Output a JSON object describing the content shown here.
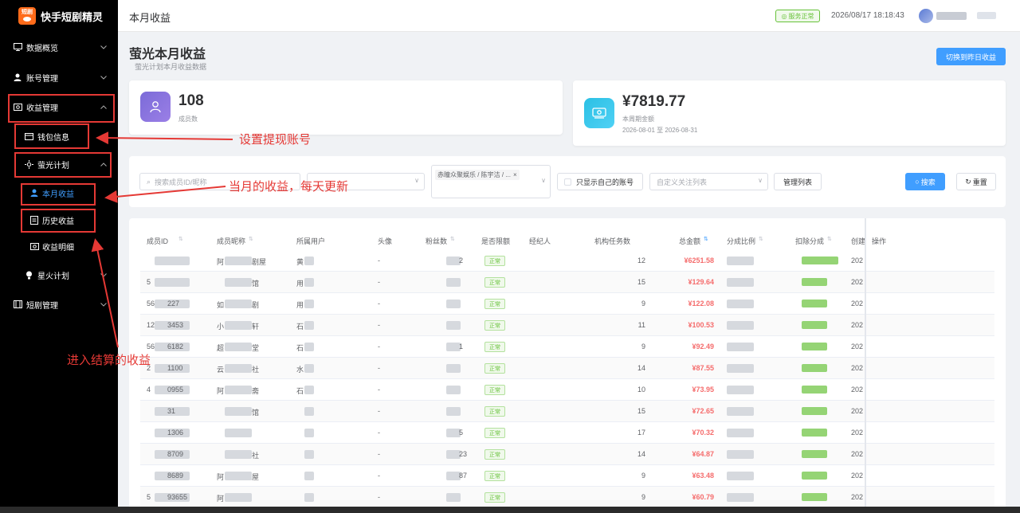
{
  "app": {
    "title": "快手短剧精灵",
    "logo_text": "短剧"
  },
  "sidebar": {
    "items": [
      {
        "label": "数据概览",
        "icon": "monitor-icon"
      },
      {
        "label": "账号管理",
        "icon": "user-icon"
      },
      {
        "label": "收益管理",
        "icon": "money-icon"
      },
      {
        "label": "钱包信息",
        "icon": "wallet-icon"
      },
      {
        "label": "萤光计划",
        "icon": "sun-icon"
      },
      {
        "label": "本月收益",
        "icon": "user-icon"
      },
      {
        "label": "历史收益",
        "icon": "document-icon"
      },
      {
        "label": "收益明细",
        "icon": "money-icon"
      },
      {
        "label": "星火计划",
        "icon": "bulb-icon"
      },
      {
        "label": "短剧管理",
        "icon": "film-icon"
      }
    ]
  },
  "header": {
    "page_title": "本月收益",
    "status": "服务正常",
    "datetime": "2026/08/17 18:18:43"
  },
  "page": {
    "title": "萤光本月收益",
    "subtitle": "萤光计划本月收益数据",
    "switch_button": "切换到昨日收益"
  },
  "stats": {
    "members": {
      "value": "108",
      "label": "成员数"
    },
    "amount": {
      "value": "¥7819.77",
      "label": "本周期金额",
      "period": "2026-08-01 至 2026-08-31"
    }
  },
  "filters": {
    "search_placeholder": "搜索成员ID/昵称",
    "tag_value": "赤瞳众聚娱乐 / 陈宇洁 / ...",
    "own_only_label": "只显示自己的账号",
    "custom_list_placeholder": "自定义关注列表",
    "manage_list": "管理列表",
    "search_button": "搜索",
    "reset_button": "重置"
  },
  "table": {
    "columns": [
      "成员ID",
      "成员昵称",
      "所属用户",
      "头像",
      "粉丝数",
      "是否限额",
      "经纪人",
      "机构任务数",
      "总金额",
      "分成比例",
      "扣除分成",
      "创建",
      "操作"
    ],
    "rows": [
      {
        "id": "",
        "nick": "阿",
        "nick2": "剧屋",
        "user": "黄",
        "avatar": "-",
        "fans": "2",
        "limit": "正常",
        "tasks": "12",
        "amount": "¥6251.58",
        "created": "202"
      },
      {
        "id": "5",
        "nick": "",
        "nick2": "馆",
        "user": "用",
        "avatar": "-",
        "fans": "",
        "limit": "正常",
        "tasks": "15",
        "amount": "¥129.64",
        "created": "202"
      },
      {
        "id": "56",
        "id2": "227",
        "nick": "如",
        "nick2": "剧",
        "user": "用",
        "avatar": "-",
        "fans": "",
        "limit": "正常",
        "tasks": "9",
        "amount": "¥122.08",
        "created": "202"
      },
      {
        "id": "12",
        "id2": "3453",
        "nick": "小",
        "nick2": "轩",
        "user": "石",
        "avatar": "-",
        "fans": "",
        "limit": "正常",
        "tasks": "11",
        "amount": "¥100.53",
        "created": "202"
      },
      {
        "id": "56",
        "id2": "6182",
        "nick": "超",
        "nick2": "堂",
        "user": "石",
        "avatar": "-",
        "fans": "1",
        "limit": "正常",
        "tasks": "9",
        "amount": "¥92.49",
        "created": "202"
      },
      {
        "id": "2",
        "id2": "1100",
        "nick": "云",
        "nick2": "社",
        "user": "水",
        "avatar": "-",
        "fans": "",
        "limit": "正常",
        "tasks": "14",
        "amount": "¥87.55",
        "created": "202"
      },
      {
        "id": "4",
        "id2": "0955",
        "nick": "阿",
        "nick2": "斋",
        "user": "石",
        "avatar": "-",
        "fans": "",
        "limit": "正常",
        "tasks": "10",
        "amount": "¥73.95",
        "created": "202"
      },
      {
        "id": "",
        "id2": "31",
        "nick": "",
        "nick2": "馆",
        "user": "",
        "avatar": "-",
        "fans": "",
        "limit": "正常",
        "tasks": "15",
        "amount": "¥72.65",
        "created": "202"
      },
      {
        "id": "",
        "id2": "1306",
        "nick": "",
        "nick2": "",
        "user": "",
        "avatar": "-",
        "fans": "5",
        "limit": "正常",
        "tasks": "17",
        "amount": "¥70.32",
        "created": "202"
      },
      {
        "id": "",
        "id2": "8709",
        "nick": "",
        "nick2": "社",
        "user": "",
        "avatar": "-",
        "fans": "23",
        "limit": "正常",
        "tasks": "14",
        "amount": "¥64.87",
        "created": "202"
      },
      {
        "id": "",
        "id2": "8689",
        "nick": "阿",
        "nick2": "屋",
        "user": "",
        "avatar": "-",
        "fans": "87",
        "limit": "正常",
        "tasks": "9",
        "amount": "¥63.48",
        "created": "202"
      },
      {
        "id": "5",
        "id2": "93655",
        "nick": "阿",
        "nick2": "",
        "user": "",
        "avatar": "-",
        "fans": "",
        "limit": "正常",
        "tasks": "9",
        "amount": "¥60.79",
        "created": "202"
      }
    ]
  },
  "annotations": {
    "wallet": "设置提现账号",
    "monthly": "当月的收益，每天更新",
    "history": "进入结算的收益"
  },
  "colors": {
    "primary": "#409eff",
    "danger": "#f56c6c",
    "success": "#67c23a",
    "annotation": "#e53935"
  }
}
